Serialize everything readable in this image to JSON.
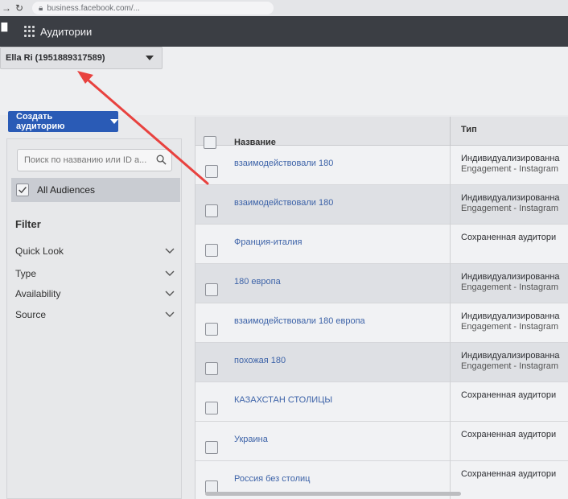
{
  "browser": {
    "url": "business.facebook.com/..."
  },
  "topbar": {
    "title": "Аудитории"
  },
  "account": {
    "selected": "Ella Ri (1951889317589)"
  },
  "toolbar": {
    "create_label": "Создать аудиторию"
  },
  "sidebar": {
    "search_placeholder": "Поиск по названию или ID а...",
    "all_audiences": "All Audiences",
    "filter_title": "Filter",
    "filters": [
      "Quick Look",
      "Type",
      "Availability",
      "Source"
    ]
  },
  "table": {
    "headers": {
      "name": "Название",
      "type": "Тип"
    },
    "rows": [
      {
        "name": "взаимодействовали 180",
        "type": "Индивидуализированна",
        "subtype": "Engagement - Instagram"
      },
      {
        "name": "взаимодействовали 180",
        "type": "Индивидуализированна",
        "subtype": "Engagement - Instagram"
      },
      {
        "name": "Франция-италия",
        "type": "Сохраненная аудитори",
        "subtype": ""
      },
      {
        "name": "180 европа",
        "type": "Индивидуализированна",
        "subtype": "Engagement - Instagram"
      },
      {
        "name": "взаимодействовали 180 европа",
        "type": "Индивидуализированна",
        "subtype": "Engagement - Instagram"
      },
      {
        "name": "похожая 180",
        "type": "Индивидуализированна",
        "subtype": "Engagement - Instagram"
      },
      {
        "name": "КАЗАХСТАН СТОЛИЦЫ",
        "type": "Сохраненная аудитори",
        "subtype": ""
      },
      {
        "name": "Украина",
        "type": "Сохраненная аудитори",
        "subtype": ""
      },
      {
        "name": "Россия без столиц",
        "type": "Сохраненная аудитори",
        "subtype": ""
      }
    ]
  },
  "colors": {
    "accent": "#2a5bb6",
    "annotation_arrow": "#e8423f",
    "header": "#3b3e44"
  }
}
